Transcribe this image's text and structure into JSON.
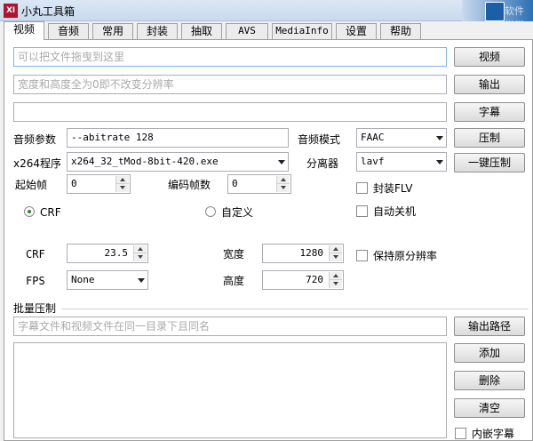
{
  "window": {
    "title": "小丸工具箱",
    "watermark": "软件学堂"
  },
  "tabs": [
    {
      "label": "视频",
      "active": true
    },
    {
      "label": "音频"
    },
    {
      "label": "常用"
    },
    {
      "label": "封装"
    },
    {
      "label": "抽取"
    },
    {
      "label": "AVS"
    },
    {
      "label": "MediaInfo"
    },
    {
      "label": "设置"
    },
    {
      "label": "帮助"
    }
  ],
  "video": {
    "input_placeholder": "可以把文件拖曳到这里",
    "output_placeholder": "宽度和高度全为0即不改变分辨率",
    "subtitle_value": "",
    "buttons": {
      "video": "视频",
      "output": "输出",
      "subtitle": "字幕",
      "compress": "压制",
      "one_click": "一键压制"
    },
    "audio_params_label": "音频参数",
    "audio_params_value": "--abitrate 128",
    "audio_mode_label": "音频模式",
    "audio_mode_value": "FAAC",
    "x264_label": "x264程序",
    "x264_value": "x264_32_tMod-8bit-420.exe",
    "demuxer_label": "分离器",
    "demuxer_value": "lavf",
    "start_frame_label": "起始帧",
    "start_frame_value": "0",
    "encode_frames_label": "编码帧数",
    "encode_frames_value": "0",
    "mux_flv_label": "封装FLV",
    "auto_shutdown_label": "自动关机",
    "radio_crf_label": "CRF",
    "radio_custom_label": "自定义",
    "crf_label": "CRF",
    "crf_value": "23.5",
    "fps_label": "FPS",
    "fps_value": "None",
    "width_label": "宽度",
    "width_value": "1280",
    "height_label": "高度",
    "height_value": "720",
    "keep_res_label": "保持原分辨率",
    "batch_title": "批量压制",
    "batch_placeholder": "字幕文件和视频文件在同一目录下且同名",
    "batch_buttons": {
      "output_path": "输出路径",
      "add": "添加",
      "delete": "删除",
      "clear": "清空",
      "embed_sub": "内嵌字幕"
    }
  }
}
